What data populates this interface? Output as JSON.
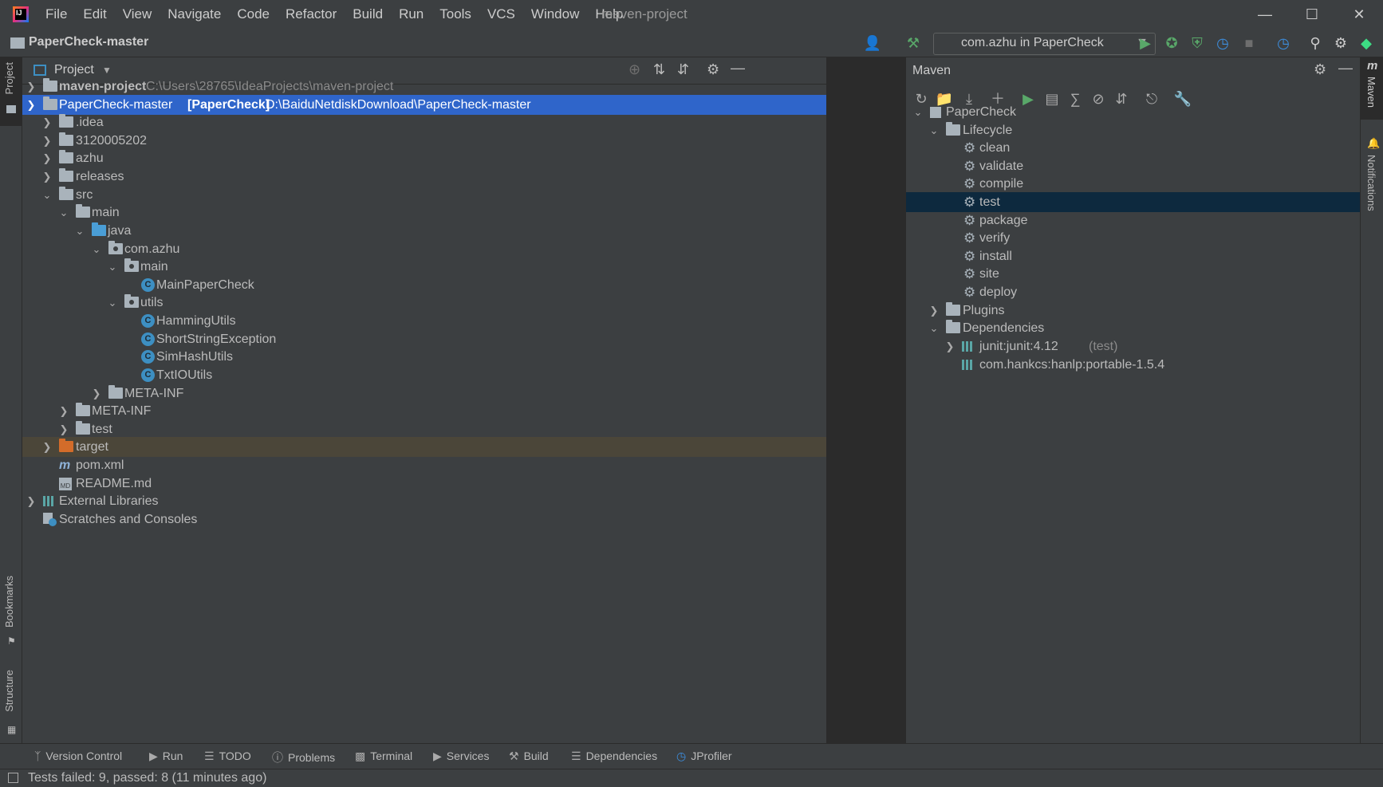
{
  "menu": {
    "items": [
      "File",
      "Edit",
      "View",
      "Navigate",
      "Code",
      "Refactor",
      "Build",
      "Run",
      "Tools",
      "VCS",
      "Window",
      "Help"
    ],
    "window_title": "maven-project"
  },
  "navbar": {
    "breadcrumb": "PaperCheck-master",
    "run_config": "com.azhu in PaperCheck"
  },
  "left_stripe": {
    "project": "Project",
    "bookmarks": "Bookmarks",
    "structure": "Structure"
  },
  "project_panel": {
    "title": "Project",
    "tree": [
      {
        "label": "maven-project",
        "path": "C:\\Users\\28765\\IdeaProjects\\maven-project"
      },
      {
        "label": "PaperCheck-master",
        "module": "[PaperCheck]",
        "path": "D:\\BaiduNetdiskDownload\\PaperCheck-master"
      },
      {
        "label": ".idea"
      },
      {
        "label": "3120005202"
      },
      {
        "label": "azhu"
      },
      {
        "label": "releases"
      },
      {
        "label": "src"
      },
      {
        "label": "main"
      },
      {
        "label": "java"
      },
      {
        "label": "com.azhu"
      },
      {
        "label": "main"
      },
      {
        "label": "MainPaperCheck"
      },
      {
        "label": "utils"
      },
      {
        "label": "HammingUtils"
      },
      {
        "label": "ShortStringException"
      },
      {
        "label": "SimHashUtils"
      },
      {
        "label": "TxtIOUtils"
      },
      {
        "label": "META-INF"
      },
      {
        "label": "META-INF"
      },
      {
        "label": "test"
      },
      {
        "label": "target"
      },
      {
        "label": "pom.xml"
      },
      {
        "label": "README.md"
      },
      {
        "label": "External Libraries"
      },
      {
        "label": "Scratches and Consoles"
      }
    ]
  },
  "maven_panel": {
    "title": "Maven",
    "tree": [
      {
        "label": "PaperCheck"
      },
      {
        "label": "Lifecycle"
      },
      {
        "label": "clean"
      },
      {
        "label": "validate"
      },
      {
        "label": "compile"
      },
      {
        "label": "test"
      },
      {
        "label": "package"
      },
      {
        "label": "verify"
      },
      {
        "label": "install"
      },
      {
        "label": "site"
      },
      {
        "label": "deploy"
      },
      {
        "label": "Plugins"
      },
      {
        "label": "Dependencies"
      },
      {
        "label": "junit:junit:4.12",
        "scope": "(test)"
      },
      {
        "label": "com.hankcs:hanlp:portable-1.5.4"
      }
    ]
  },
  "right_stripe": {
    "maven": "Maven",
    "notifications": "Notifications"
  },
  "bottom_tabs": [
    "Version Control",
    "Run",
    "TODO",
    "Problems",
    "Terminal",
    "Services",
    "Build",
    "Dependencies",
    "JProfiler"
  ],
  "status": "Tests failed: 9, passed: 8 (11 minutes ago)",
  "colors": {
    "selection": "#2f65ca",
    "maven_selection": "#0d293e",
    "excluded": "#4b4639",
    "run_green": "#59a869"
  }
}
